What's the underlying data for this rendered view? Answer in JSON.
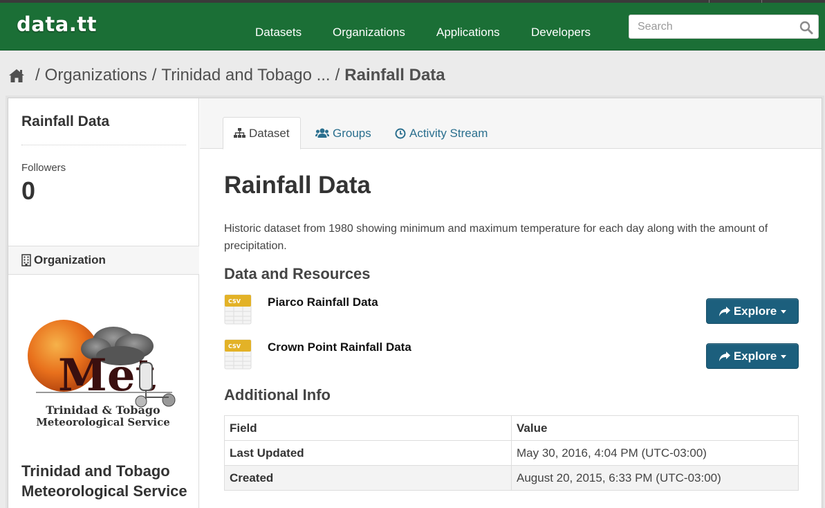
{
  "site": {
    "logo": "data.tt",
    "nav": [
      "Datasets",
      "Organizations",
      "Applications",
      "Developers"
    ],
    "search_placeholder": "Search"
  },
  "breadcrumb": {
    "items": [
      "Organizations",
      "Trinidad and Tobago ...",
      "Rainfall Data"
    ]
  },
  "sidebar": {
    "title": "Rainfall Data",
    "followers_label": "Followers",
    "followers_count": "0",
    "org_heading": "Organization",
    "org_logo_text": "Met",
    "org_logo_caption_1": "Trinidad & Tobago",
    "org_logo_caption_2": "Meteorological Service",
    "org_name": "Trinidad and Tobago Meteorological Service"
  },
  "tabs": [
    "Dataset",
    "Groups",
    "Activity Stream"
  ],
  "dataset": {
    "title": "Rainfall Data",
    "description": "Historic dataset from 1980 showing minimum and maximum temperature for each day along with the amount of precipitation.",
    "resources_heading": "Data and Resources",
    "resources": [
      {
        "name": "Piarco Rainfall Data",
        "format": "CSV",
        "action": "Explore"
      },
      {
        "name": "Crown Point Rainfall Data",
        "format": "CSV",
        "action": "Explore"
      }
    ],
    "additional_heading": "Additional Info",
    "table_headers": [
      "Field",
      "Value"
    ],
    "table_rows": [
      {
        "field": "Last Updated",
        "value": "May 30, 2016, 4:04 PM (UTC-03:00)"
      },
      {
        "field": "Created",
        "value": "August 20, 2015, 6:33 PM (UTC-03:00)"
      }
    ]
  },
  "colors": {
    "navbar": "#1b6f36",
    "link": "#2a6f8e",
    "button": "#1c5f7d"
  }
}
